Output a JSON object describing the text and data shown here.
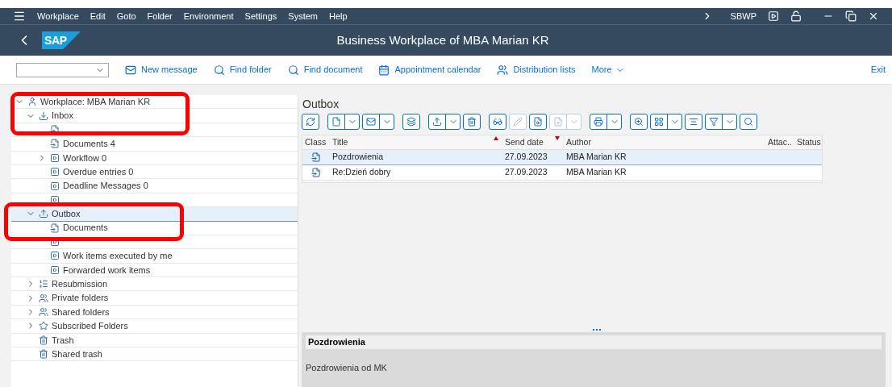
{
  "menu_bar": {
    "items": [
      "Workplace",
      "Edit",
      "Goto",
      "Folder",
      "Environment",
      "Settings",
      "System",
      "Help"
    ],
    "transaction": "SBWP"
  },
  "title_bar": {
    "logo": "SAP",
    "title": "Business Workplace of MBA Marian KR"
  },
  "toolbar": {
    "buttons": [
      "New message",
      "Find folder",
      "Find document",
      "Appointment calendar",
      "Distribution lists"
    ],
    "more": "More",
    "exit": "Exit"
  },
  "tree": [
    {
      "label": "Workplace: MBA Marian KR",
      "kind": "workplace",
      "expanded": true,
      "selected": false,
      "children": [
        {
          "label": "Inbox",
          "kind": "inbox",
          "expanded": true,
          "selected": false,
          "children": [
            {
              "kind": "document",
              "selected": false
            },
            {
              "label": "Documents 4",
              "kind": "document",
              "selected": false
            },
            {
              "label": "Workflow 0",
              "kind": "workflow",
              "expanded": false,
              "selected": false
            },
            {
              "label": "Overdue entries 0",
              "kind": "workflow",
              "selected": false
            },
            {
              "label": "Deadline Messages 0",
              "kind": "workflow",
              "selected": false
            },
            {
              "kind": "workflow",
              "selected": false
            }
          ]
        },
        {
          "label": "Outbox",
          "kind": "outbox",
          "expanded": true,
          "selected": true,
          "children": [
            {
              "label": "Documents",
              "kind": "document",
              "selected": false
            },
            {
              "kind": "workflow",
              "selected": false
            },
            {
              "label": "Work items executed by me",
              "kind": "workflow",
              "selected": false
            },
            {
              "label": "Forwarded work items",
              "kind": "workflow",
              "selected": false
            }
          ]
        },
        {
          "label": "Resubmission",
          "kind": "resubmission",
          "expanded": false,
          "selected": false
        },
        {
          "label": "Private folders",
          "kind": "private",
          "expanded": false,
          "selected": false
        },
        {
          "label": "Shared folders",
          "kind": "shared",
          "expanded": false,
          "selected": false
        },
        {
          "label": "Subscribed Folders",
          "kind": "subscribed",
          "expanded": false,
          "selected": false
        },
        {
          "label": "Trash",
          "kind": "trash",
          "selected": false
        },
        {
          "label": "Shared trash",
          "kind": "trash",
          "selected": false
        }
      ]
    }
  ],
  "outbox": {
    "title": "Outbox",
    "tools": [
      {
        "disabled": false,
        "dropdown": false
      },
      {
        "disabled": false,
        "dropdown": true
      },
      {
        "disabled": false,
        "dropdown": true
      },
      {
        "disabled": false,
        "dropdown": false
      },
      {
        "disabled": false,
        "dropdown": true
      },
      {
        "disabled": false,
        "dropdown": false
      },
      {
        "disabled": false,
        "dropdown": false
      },
      {
        "disabled": true,
        "dropdown": false
      },
      {
        "disabled": false,
        "dropdown": false
      },
      {
        "disabled": true,
        "dropdown": true
      },
      {
        "disabled": false,
        "dropdown": true
      },
      {
        "disabled": false,
        "dropdown": false
      },
      {
        "disabled": false,
        "dropdown": true
      },
      {
        "disabled": false,
        "dropdown": false
      },
      {
        "disabled": false,
        "dropdown": true
      },
      {
        "disabled": false,
        "dropdown": false
      }
    ],
    "columns": [
      {
        "label": "Class",
        "sorted_asc": false,
        "sorted_desc": false
      },
      {
        "label": "Title",
        "sorted_asc": true,
        "sorted_desc": false
      },
      {
        "label": "Send date",
        "sorted_asc": false,
        "sorted_desc": true
      },
      {
        "label": "Author",
        "sorted_asc": false,
        "sorted_desc": false
      },
      {
        "label": "Attac..",
        "sorted_asc": false,
        "sorted_desc": false
      },
      {
        "label": "Status",
        "sorted_asc": false,
        "sorted_desc": false
      }
    ],
    "rows": [
      {
        "selected": true,
        "title": "Pozdrowienia",
        "send_date": "27.09.2023",
        "author": "MBA Marian KR"
      },
      {
        "selected": false,
        "title": "Re:Dzień dobry",
        "send_date": "27.09.2023",
        "author": "MBA Marian KR"
      }
    ]
  },
  "preview": {
    "subject": "Pozdrowienia",
    "body": "Pozdrowienia od MK"
  }
}
